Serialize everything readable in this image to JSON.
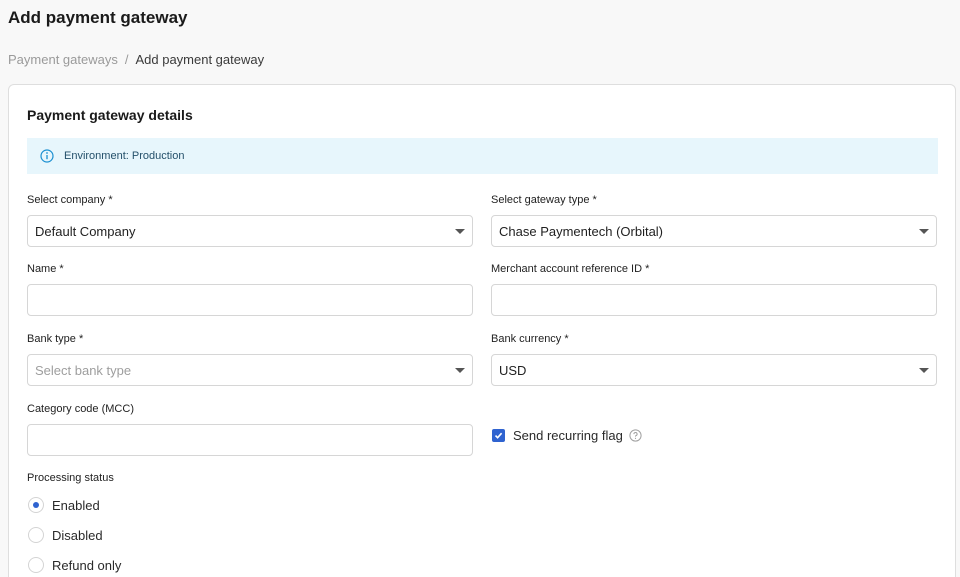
{
  "page": {
    "title": "Add payment gateway",
    "breadcrumb": {
      "parent": "Payment gateways",
      "separator": "/",
      "current": "Add payment gateway"
    }
  },
  "card": {
    "title": "Payment gateway details",
    "banner": {
      "icon": "info-icon",
      "text": "Environment: Production",
      "color": "#e7f6fc"
    }
  },
  "form": {
    "company": {
      "label": "Select company *",
      "value": "Default Company"
    },
    "gateway_type": {
      "label": "Select gateway type *",
      "value": "Chase Paymentech (Orbital)"
    },
    "name": {
      "label": "Name *",
      "value": ""
    },
    "merchant_ref": {
      "label": "Merchant account reference ID *",
      "value": ""
    },
    "bank_type": {
      "label": "Bank type *",
      "placeholder": "Select bank type"
    },
    "bank_currency": {
      "label": "Bank currency *",
      "value": "USD"
    },
    "category_code": {
      "label": "Category code (MCC)",
      "value": ""
    },
    "recurring_flag": {
      "label": "Send recurring flag",
      "checked": true,
      "help_icon": "question-circle-icon"
    },
    "processing_status": {
      "label": "Processing status",
      "options": [
        {
          "label": "Enabled",
          "selected": true
        },
        {
          "label": "Disabled",
          "selected": false
        },
        {
          "label": "Refund only",
          "selected": false
        }
      ]
    }
  },
  "colors": {
    "accent": "#2f63d0",
    "banner_bg": "#e7f6fc",
    "border": "#d6d6d6"
  }
}
